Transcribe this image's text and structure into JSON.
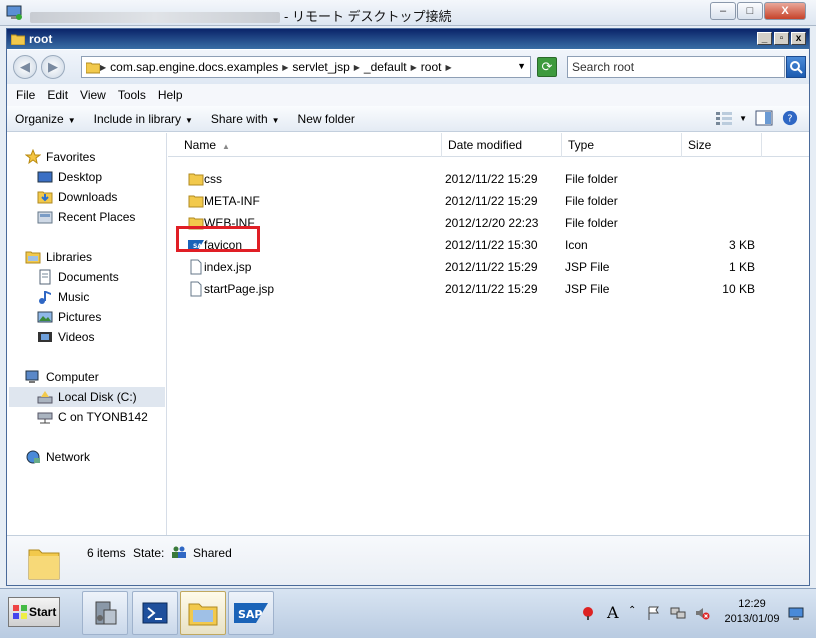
{
  "rdp_window": {
    "title_suffix": "- リモート デスクトップ接続",
    "btn_min": "–",
    "btn_max": "□",
    "btn_close": "X"
  },
  "explorer": {
    "title": "root",
    "title_btns": [
      "_",
      "▫",
      "x"
    ],
    "breadcrumb": [
      "com.sap.engine.docs.examples",
      "servlet_jsp",
      "_default",
      "root"
    ],
    "search_placeholder": "Search root",
    "menu": [
      "File",
      "Edit",
      "View",
      "Tools",
      "Help"
    ],
    "toolbar": [
      "Organize",
      "Include in library",
      "Share with",
      "New folder"
    ]
  },
  "nav": {
    "favorites_label": "Favorites",
    "favorites": [
      "Desktop",
      "Downloads",
      "Recent Places"
    ],
    "libraries_label": "Libraries",
    "libraries": [
      "Documents",
      "Music",
      "Pictures",
      "Videos"
    ],
    "computer_label": "Computer",
    "computer": [
      "Local Disk (C:)",
      "C on TYONB142"
    ],
    "network_label": "Network"
  },
  "columns": {
    "name": "Name",
    "date": "Date modified",
    "type": "Type",
    "size": "Size"
  },
  "files": [
    {
      "name": "css",
      "date": "2012/11/22 15:29",
      "type": "File folder",
      "size": "",
      "icon": "folder-icon"
    },
    {
      "name": "META-INF",
      "date": "2012/11/22 15:29",
      "type": "File folder",
      "size": "",
      "icon": "folder-icon"
    },
    {
      "name": "WEB-INF",
      "date": "2012/12/20 22:23",
      "type": "File folder",
      "size": "",
      "icon": "folder-icon"
    },
    {
      "name": "favicon",
      "date": "2012/11/22 15:30",
      "type": "Icon",
      "size": "3 KB",
      "icon": "sap-icon"
    },
    {
      "name": "index.jsp",
      "date": "2012/11/22 15:29",
      "type": "JSP File",
      "size": "1 KB",
      "icon": "file-icon"
    },
    {
      "name": "startPage.jsp",
      "date": "2012/11/22 15:29",
      "type": "JSP File",
      "size": "10 KB",
      "icon": "file-icon"
    }
  ],
  "details": {
    "count": "6 items",
    "state_label": "State:",
    "state_value": "Shared"
  },
  "taskbar": {
    "start_label": "Start",
    "sap_label": "SAP",
    "tray_lang": "A",
    "clock_time": "12:29",
    "clock_date": "2013/01/09"
  },
  "colors": {
    "highlight": "#e01e25",
    "titlebar": "#0a246a",
    "accent": "#1c5bb0"
  }
}
